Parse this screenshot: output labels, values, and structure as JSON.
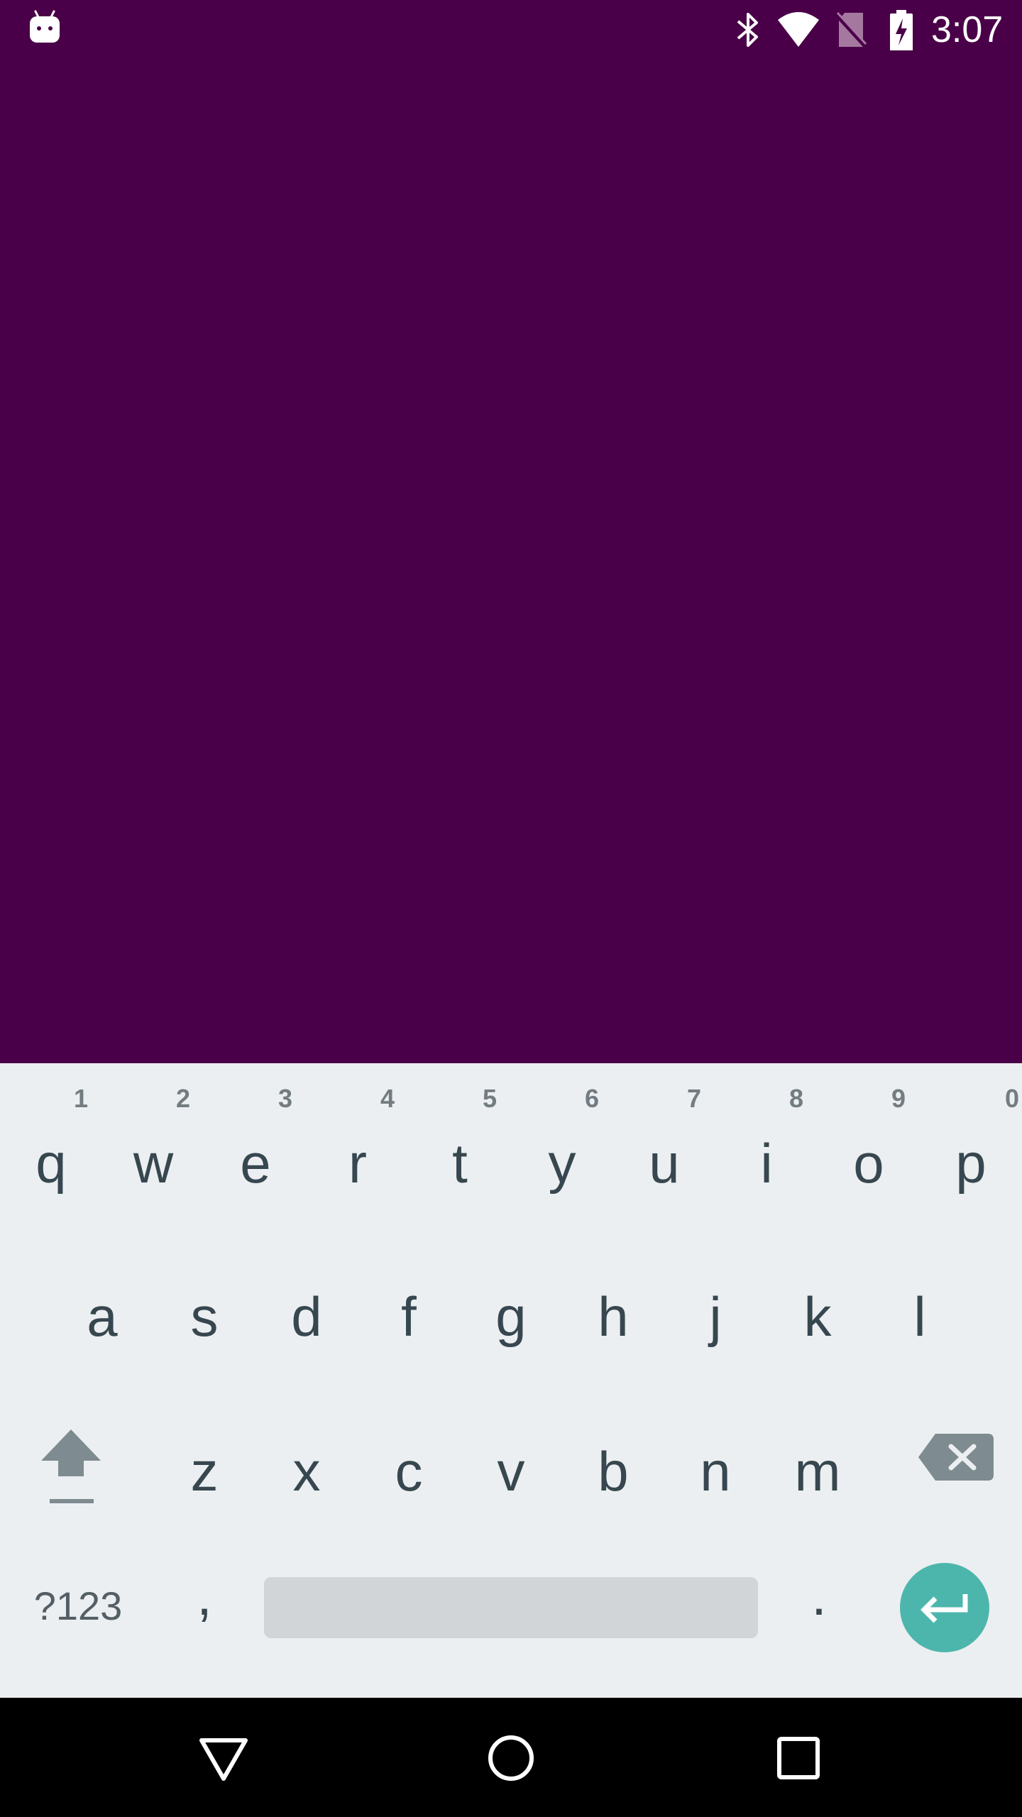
{
  "status_bar": {
    "time": "3:07",
    "icons": [
      "android-notification-icon",
      "bluetooth-icon",
      "wifi-icon",
      "no-sim-icon",
      "battery-charging-icon"
    ]
  },
  "colors": {
    "background": "#4a0048",
    "keyboard_bg": "#eceff1",
    "key_text": "#37474f",
    "accent_enter": "#4db6ac",
    "space_bar": "#d1d5d7",
    "nav_bar": "#000000"
  },
  "keyboard": {
    "row1": [
      {
        "label": "q",
        "hint": "1"
      },
      {
        "label": "w",
        "hint": "2"
      },
      {
        "label": "e",
        "hint": "3"
      },
      {
        "label": "r",
        "hint": "4"
      },
      {
        "label": "t",
        "hint": "5"
      },
      {
        "label": "y",
        "hint": "6"
      },
      {
        "label": "u",
        "hint": "7"
      },
      {
        "label": "i",
        "hint": "8"
      },
      {
        "label": "o",
        "hint": "9"
      },
      {
        "label": "p",
        "hint": "0"
      }
    ],
    "row2": [
      "a",
      "s",
      "d",
      "f",
      "g",
      "h",
      "j",
      "k",
      "l"
    ],
    "row3": [
      "z",
      "x",
      "c",
      "v",
      "b",
      "n",
      "m"
    ],
    "symbols_label": "?123",
    "comma_label": ",",
    "period_label": "."
  },
  "nav_bar": {
    "icons": [
      "back-icon",
      "home-icon",
      "recents-icon"
    ]
  }
}
